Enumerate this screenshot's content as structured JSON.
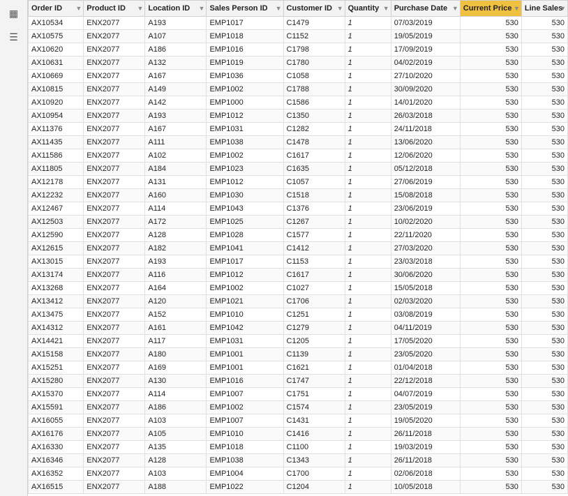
{
  "columns": [
    {
      "key": "order_id",
      "label": "Order ID",
      "class": "col-order",
      "sortable": true,
      "active": false
    },
    {
      "key": "product_id",
      "label": "Product ID",
      "class": "col-product",
      "sortable": true,
      "active": false
    },
    {
      "key": "location_id",
      "label": "Location ID",
      "class": "col-location",
      "sortable": true,
      "active": false
    },
    {
      "key": "sales_person_id",
      "label": "Sales Person ID",
      "class": "col-salesperson",
      "sortable": true,
      "active": false
    },
    {
      "key": "customer_id",
      "label": "Customer ID",
      "class": "col-customer",
      "sortable": true,
      "active": false
    },
    {
      "key": "quantity",
      "label": "Quantity",
      "class": "col-quantity",
      "sortable": true,
      "active": false
    },
    {
      "key": "purchase_date",
      "label": "Purchase Date",
      "class": "col-purchasedate",
      "sortable": true,
      "active": false
    },
    {
      "key": "current_price",
      "label": "Current Price",
      "class": "col-currentprice",
      "sortable": true,
      "active": true
    },
    {
      "key": "line_sales",
      "label": "Line Sales",
      "class": "col-linesales",
      "sortable": true,
      "active": false
    }
  ],
  "rows": [
    {
      "order_id": "AX10534",
      "product_id": "ENX2077",
      "location_id": "A193",
      "sales_person_id": "EMP1017",
      "customer_id": "C1479",
      "quantity": "1",
      "purchase_date": "07/03/2019",
      "current_price": "530",
      "line_sales": "530"
    },
    {
      "order_id": "AX10575",
      "product_id": "ENX2077",
      "location_id": "A107",
      "sales_person_id": "EMP1018",
      "customer_id": "C1152",
      "quantity": "1",
      "purchase_date": "19/05/2019",
      "current_price": "530",
      "line_sales": "530"
    },
    {
      "order_id": "AX10620",
      "product_id": "ENX2077",
      "location_id": "A186",
      "sales_person_id": "EMP1016",
      "customer_id": "C1798",
      "quantity": "1",
      "purchase_date": "17/09/2019",
      "current_price": "530",
      "line_sales": "530"
    },
    {
      "order_id": "AX10631",
      "product_id": "ENX2077",
      "location_id": "A132",
      "sales_person_id": "EMP1019",
      "customer_id": "C1780",
      "quantity": "1",
      "purchase_date": "04/02/2019",
      "current_price": "530",
      "line_sales": "530"
    },
    {
      "order_id": "AX10669",
      "product_id": "ENX2077",
      "location_id": "A167",
      "sales_person_id": "EMP1036",
      "customer_id": "C1058",
      "quantity": "1",
      "purchase_date": "27/10/2020",
      "current_price": "530",
      "line_sales": "530"
    },
    {
      "order_id": "AX10815",
      "product_id": "ENX2077",
      "location_id": "A149",
      "sales_person_id": "EMP1002",
      "customer_id": "C1788",
      "quantity": "1",
      "purchase_date": "30/09/2020",
      "current_price": "530",
      "line_sales": "530"
    },
    {
      "order_id": "AX10920",
      "product_id": "ENX2077",
      "location_id": "A142",
      "sales_person_id": "EMP1000",
      "customer_id": "C1586",
      "quantity": "1",
      "purchase_date": "14/01/2020",
      "current_price": "530",
      "line_sales": "530"
    },
    {
      "order_id": "AX10954",
      "product_id": "ENX2077",
      "location_id": "A193",
      "sales_person_id": "EMP1012",
      "customer_id": "C1350",
      "quantity": "1",
      "purchase_date": "26/03/2018",
      "current_price": "530",
      "line_sales": "530"
    },
    {
      "order_id": "AX11376",
      "product_id": "ENX2077",
      "location_id": "A167",
      "sales_person_id": "EMP1031",
      "customer_id": "C1282",
      "quantity": "1",
      "purchase_date": "24/11/2018",
      "current_price": "530",
      "line_sales": "530"
    },
    {
      "order_id": "AX11435",
      "product_id": "ENX2077",
      "location_id": "A111",
      "sales_person_id": "EMP1038",
      "customer_id": "C1478",
      "quantity": "1",
      "purchase_date": "13/06/2020",
      "current_price": "530",
      "line_sales": "530"
    },
    {
      "order_id": "AX11586",
      "product_id": "ENX2077",
      "location_id": "A102",
      "sales_person_id": "EMP1002",
      "customer_id": "C1617",
      "quantity": "1",
      "purchase_date": "12/06/2020",
      "current_price": "530",
      "line_sales": "530"
    },
    {
      "order_id": "AX11805",
      "product_id": "ENX2077",
      "location_id": "A184",
      "sales_person_id": "EMP1023",
      "customer_id": "C1635",
      "quantity": "1",
      "purchase_date": "05/12/2018",
      "current_price": "530",
      "line_sales": "530"
    },
    {
      "order_id": "AX12178",
      "product_id": "ENX2077",
      "location_id": "A131",
      "sales_person_id": "EMP1012",
      "customer_id": "C1057",
      "quantity": "1",
      "purchase_date": "27/06/2019",
      "current_price": "530",
      "line_sales": "530"
    },
    {
      "order_id": "AX12232",
      "product_id": "ENX2077",
      "location_id": "A160",
      "sales_person_id": "EMP1030",
      "customer_id": "C1518",
      "quantity": "1",
      "purchase_date": "15/08/2018",
      "current_price": "530",
      "line_sales": "530"
    },
    {
      "order_id": "AX12467",
      "product_id": "ENX2077",
      "location_id": "A114",
      "sales_person_id": "EMP1043",
      "customer_id": "C1376",
      "quantity": "1",
      "purchase_date": "23/06/2019",
      "current_price": "530",
      "line_sales": "530"
    },
    {
      "order_id": "AX12503",
      "product_id": "ENX2077",
      "location_id": "A172",
      "sales_person_id": "EMP1025",
      "customer_id": "C1267",
      "quantity": "1",
      "purchase_date": "10/02/2020",
      "current_price": "530",
      "line_sales": "530"
    },
    {
      "order_id": "AX12590",
      "product_id": "ENX2077",
      "location_id": "A128",
      "sales_person_id": "EMP1028",
      "customer_id": "C1577",
      "quantity": "1",
      "purchase_date": "22/11/2020",
      "current_price": "530",
      "line_sales": "530"
    },
    {
      "order_id": "AX12615",
      "product_id": "ENX2077",
      "location_id": "A182",
      "sales_person_id": "EMP1041",
      "customer_id": "C1412",
      "quantity": "1",
      "purchase_date": "27/03/2020",
      "current_price": "530",
      "line_sales": "530"
    },
    {
      "order_id": "AX13015",
      "product_id": "ENX2077",
      "location_id": "A193",
      "sales_person_id": "EMP1017",
      "customer_id": "C1153",
      "quantity": "1",
      "purchase_date": "23/03/2018",
      "current_price": "530",
      "line_sales": "530"
    },
    {
      "order_id": "AX13174",
      "product_id": "ENX2077",
      "location_id": "A116",
      "sales_person_id": "EMP1012",
      "customer_id": "C1617",
      "quantity": "1",
      "purchase_date": "30/06/2020",
      "current_price": "530",
      "line_sales": "530"
    },
    {
      "order_id": "AX13268",
      "product_id": "ENX2077",
      "location_id": "A164",
      "sales_person_id": "EMP1002",
      "customer_id": "C1027",
      "quantity": "1",
      "purchase_date": "15/05/2018",
      "current_price": "530",
      "line_sales": "530"
    },
    {
      "order_id": "AX13412",
      "product_id": "ENX2077",
      "location_id": "A120",
      "sales_person_id": "EMP1021",
      "customer_id": "C1706",
      "quantity": "1",
      "purchase_date": "02/03/2020",
      "current_price": "530",
      "line_sales": "530"
    },
    {
      "order_id": "AX13475",
      "product_id": "ENX2077",
      "location_id": "A152",
      "sales_person_id": "EMP1010",
      "customer_id": "C1251",
      "quantity": "1",
      "purchase_date": "03/08/2019",
      "current_price": "530",
      "line_sales": "530"
    },
    {
      "order_id": "AX14312",
      "product_id": "ENX2077",
      "location_id": "A161",
      "sales_person_id": "EMP1042",
      "customer_id": "C1279",
      "quantity": "1",
      "purchase_date": "04/11/2019",
      "current_price": "530",
      "line_sales": "530"
    },
    {
      "order_id": "AX14421",
      "product_id": "ENX2077",
      "location_id": "A117",
      "sales_person_id": "EMP1031",
      "customer_id": "C1205",
      "quantity": "1",
      "purchase_date": "17/05/2020",
      "current_price": "530",
      "line_sales": "530"
    },
    {
      "order_id": "AX15158",
      "product_id": "ENX2077",
      "location_id": "A180",
      "sales_person_id": "EMP1001",
      "customer_id": "C1139",
      "quantity": "1",
      "purchase_date": "23/05/2020",
      "current_price": "530",
      "line_sales": "530"
    },
    {
      "order_id": "AX15251",
      "product_id": "ENX2077",
      "location_id": "A169",
      "sales_person_id": "EMP1001",
      "customer_id": "C1621",
      "quantity": "1",
      "purchase_date": "01/04/2018",
      "current_price": "530",
      "line_sales": "530"
    },
    {
      "order_id": "AX15280",
      "product_id": "ENX2077",
      "location_id": "A130",
      "sales_person_id": "EMP1016",
      "customer_id": "C1747",
      "quantity": "1",
      "purchase_date": "22/12/2018",
      "current_price": "530",
      "line_sales": "530"
    },
    {
      "order_id": "AX15370",
      "product_id": "ENX2077",
      "location_id": "A114",
      "sales_person_id": "EMP1007",
      "customer_id": "C1751",
      "quantity": "1",
      "purchase_date": "04/07/2019",
      "current_price": "530",
      "line_sales": "530"
    },
    {
      "order_id": "AX15591",
      "product_id": "ENX2077",
      "location_id": "A186",
      "sales_person_id": "EMP1002",
      "customer_id": "C1574",
      "quantity": "1",
      "purchase_date": "23/05/2019",
      "current_price": "530",
      "line_sales": "530"
    },
    {
      "order_id": "AX16055",
      "product_id": "ENX2077",
      "location_id": "A103",
      "sales_person_id": "EMP1007",
      "customer_id": "C1431",
      "quantity": "1",
      "purchase_date": "19/05/2020",
      "current_price": "530",
      "line_sales": "530"
    },
    {
      "order_id": "AX16176",
      "product_id": "ENX2077",
      "location_id": "A105",
      "sales_person_id": "EMP1010",
      "customer_id": "C1416",
      "quantity": "1",
      "purchase_date": "26/11/2018",
      "current_price": "530",
      "line_sales": "530"
    },
    {
      "order_id": "AX16330",
      "product_id": "ENX2077",
      "location_id": "A135",
      "sales_person_id": "EMP1018",
      "customer_id": "C1100",
      "quantity": "1",
      "purchase_date": "19/03/2019",
      "current_price": "530",
      "line_sales": "530"
    },
    {
      "order_id": "AX16346",
      "product_id": "ENX2077",
      "location_id": "A128",
      "sales_person_id": "EMP1038",
      "customer_id": "C1343",
      "quantity": "1",
      "purchase_date": "26/11/2018",
      "current_price": "530",
      "line_sales": "530"
    },
    {
      "order_id": "AX16352",
      "product_id": "ENX2077",
      "location_id": "A103",
      "sales_person_id": "EMP1004",
      "customer_id": "C1700",
      "quantity": "1",
      "purchase_date": "02/06/2018",
      "current_price": "530",
      "line_sales": "530"
    },
    {
      "order_id": "AX16515",
      "product_id": "ENX2077",
      "location_id": "A188",
      "sales_person_id": "EMP1022",
      "customer_id": "C1204",
      "quantity": "1",
      "purchase_date": "10/05/2018",
      "current_price": "530",
      "line_sales": "530"
    }
  ],
  "icons": {
    "table": "▦",
    "rows": "☰",
    "filter": "▼",
    "sort_asc": "▲",
    "sort_desc": "▼"
  }
}
